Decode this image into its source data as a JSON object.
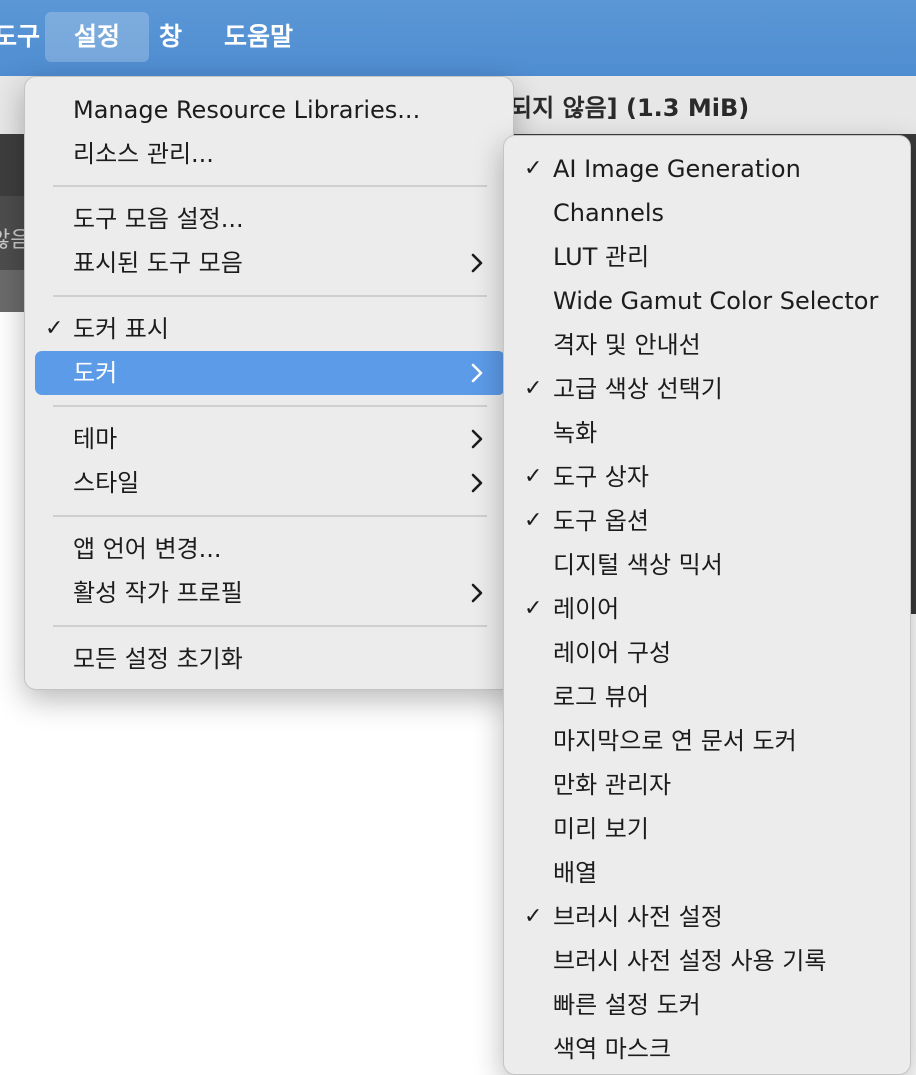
{
  "menubar": {
    "items": [
      {
        "label": "도구"
      },
      {
        "label": "설정"
      },
      {
        "label": "창"
      },
      {
        "label": "도움말"
      }
    ]
  },
  "background": {
    "title_fragment": "되지 않음]  (1.3 MiB)",
    "strip_fragment": "않음"
  },
  "settings_menu": {
    "items": [
      {
        "label": "Manage Resource Libraries...",
        "checked": false,
        "submenu": false
      },
      {
        "label": "리소스 관리...",
        "checked": false,
        "submenu": false
      },
      {
        "label": "도구 모음 설정...",
        "checked": false,
        "submenu": false
      },
      {
        "label": "표시된 도구 모음",
        "checked": false,
        "submenu": true
      },
      {
        "label": "도커 표시",
        "checked": true,
        "submenu": false
      },
      {
        "label": "도커",
        "checked": false,
        "submenu": true,
        "highlighted": true
      },
      {
        "label": "테마",
        "checked": false,
        "submenu": true
      },
      {
        "label": "스타일",
        "checked": false,
        "submenu": true
      },
      {
        "label": "앱 언어 변경...",
        "checked": false,
        "submenu": false
      },
      {
        "label": "활성 작가 프로필",
        "checked": false,
        "submenu": true
      },
      {
        "label": "모든 설정 초기화",
        "checked": false,
        "submenu": false
      }
    ],
    "check_glyph": "✓",
    "chevron_icon": "chevron-right-icon"
  },
  "dockers_submenu": {
    "items": [
      {
        "label": "AI Image Generation",
        "checked": true
      },
      {
        "label": "Channels",
        "checked": false
      },
      {
        "label": "LUT 관리",
        "checked": false
      },
      {
        "label": "Wide Gamut Color Selector",
        "checked": false
      },
      {
        "label": "격자 및 안내선",
        "checked": false
      },
      {
        "label": "고급 색상 선택기",
        "checked": true
      },
      {
        "label": "녹화",
        "checked": false
      },
      {
        "label": "도구 상자",
        "checked": true
      },
      {
        "label": "도구 옵션",
        "checked": true
      },
      {
        "label": "디지털 색상 믹서",
        "checked": false
      },
      {
        "label": "레이어",
        "checked": true
      },
      {
        "label": "레이어 구성",
        "checked": false
      },
      {
        "label": "로그 뷰어",
        "checked": false
      },
      {
        "label": "마지막으로 연 문서 도커",
        "checked": false
      },
      {
        "label": "만화 관리자",
        "checked": false
      },
      {
        "label": "미리 보기",
        "checked": false
      },
      {
        "label": "배열",
        "checked": false
      },
      {
        "label": "브러시 사전 설정",
        "checked": true
      },
      {
        "label": "브러시 사전 설정 사용 기록",
        "checked": false
      },
      {
        "label": "빠른 설정 도커",
        "checked": false
      },
      {
        "label": "색역 마스크",
        "checked": false
      }
    ]
  },
  "colors": {
    "menubar": "#5b97d6",
    "highlight": "#5c9be8",
    "menu_bg": "#ececec"
  }
}
